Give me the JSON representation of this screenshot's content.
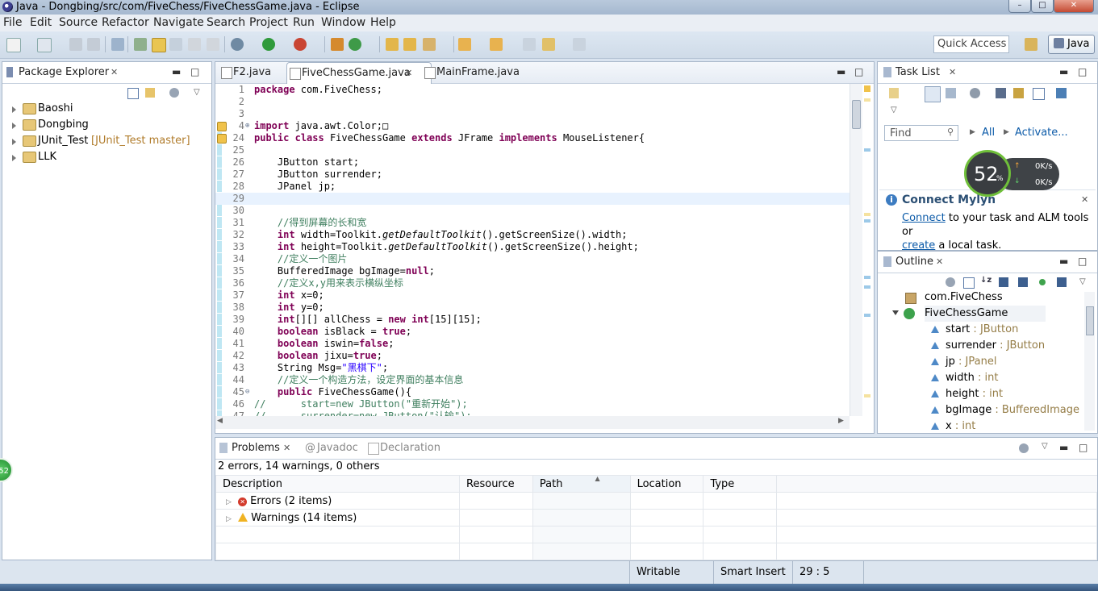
{
  "window": {
    "title": "Java - Dongbing/src/com/FiveChess/FiveChessGame.java - Eclipse"
  },
  "menu": [
    "File",
    "Edit",
    "Source",
    "Refactor",
    "Navigate",
    "Search",
    "Project",
    "Run",
    "Window",
    "Help"
  ],
  "toolbar": {
    "quick_access_placeholder": "Quick Access",
    "perspective": "Java"
  },
  "package_explorer": {
    "title": "Package Explorer",
    "projects": [
      {
        "name": "Baoshi",
        "decoration": ""
      },
      {
        "name": "Dongbing",
        "decoration": ""
      },
      {
        "name": "JUnit_Test",
        "decoration": "[JUnit_Test master]"
      },
      {
        "name": "LLK",
        "decoration": ""
      }
    ]
  },
  "editor": {
    "tabs": [
      "F2.java",
      "FiveChessGame.java",
      "MainFrame.java"
    ],
    "active_tab": "FiveChessGame.java",
    "cursor_line": 29,
    "lines": [
      {
        "n": "1",
        "t": "package com.FiveChess;"
      },
      {
        "n": "2",
        "t": ""
      },
      {
        "n": "3",
        "t": ""
      },
      {
        "n": "4",
        "t": "import java.awt.Color;□"
      },
      {
        "n": "24",
        "t": "public class FiveChessGame extends JFrame implements MouseListener{"
      },
      {
        "n": "25",
        "t": ""
      },
      {
        "n": "26",
        "t": "    JButton start;"
      },
      {
        "n": "27",
        "t": "    JButton surrender;"
      },
      {
        "n": "28",
        "t": "    JPanel jp;"
      },
      {
        "n": "29",
        "t": ""
      },
      {
        "n": "30",
        "t": ""
      },
      {
        "n": "31",
        "t": "    //得到屏幕的长和宽"
      },
      {
        "n": "32",
        "t": "    int width=Toolkit.getDefaultToolkit().getScreenSize().width;"
      },
      {
        "n": "33",
        "t": "    int height=Toolkit.getDefaultToolkit().getScreenSize().height;"
      },
      {
        "n": "34",
        "t": "    //定义一个图片"
      },
      {
        "n": "35",
        "t": "    BufferedImage bgImage=null;"
      },
      {
        "n": "36",
        "t": "    //定义x,y用来表示横纵坐标"
      },
      {
        "n": "37",
        "t": "    int x=0;"
      },
      {
        "n": "38",
        "t": "    int y=0;"
      },
      {
        "n": "39",
        "t": "    int[][] allChess = new int[15][15];"
      },
      {
        "n": "40",
        "t": "    boolean isBlack = true;"
      },
      {
        "n": "41",
        "t": "    boolean iswin=false;"
      },
      {
        "n": "42",
        "t": "    boolean jixu=true;"
      },
      {
        "n": "43",
        "t": "    String Msg=\"黑棋下\";"
      },
      {
        "n": "44",
        "t": "    //定义一个构造方法，设定界面的基本信息"
      },
      {
        "n": "45",
        "t": "    public FiveChessGame(){"
      },
      {
        "n": "46",
        "t": "//      start=new JButton(\"重新开始\");"
      },
      {
        "n": "47",
        "t": "//      surrender=new JButton(\"认输\");"
      }
    ]
  },
  "task_list": {
    "title": "Task List",
    "find_placeholder": "Find",
    "all_label": "All",
    "activate_label": "Activate...",
    "net_percent": "52",
    "net_up": "0K/s",
    "net_down": "0K/s",
    "mylyn_title": "Connect Mylyn",
    "mylyn_connect_link": "Connect",
    "mylyn_text1": " to your task and ALM tools or",
    "mylyn_create_link": "create",
    "mylyn_text2": " a local task."
  },
  "outline": {
    "title": "Outline",
    "package": "com.FiveChess",
    "class": "FiveChessGame",
    "fields": [
      {
        "name": "start",
        "type": "JButton"
      },
      {
        "name": "surrender",
        "type": "JButton"
      },
      {
        "name": "jp",
        "type": "JPanel"
      },
      {
        "name": "width",
        "type": "int"
      },
      {
        "name": "height",
        "type": "int"
      },
      {
        "name": "bgImage",
        "type": "BufferedImage"
      },
      {
        "name": "x",
        "type": "int"
      }
    ]
  },
  "problems": {
    "tabs": [
      "Problems",
      "Javadoc",
      "Declaration"
    ],
    "summary": "2 errors, 14 warnings, 0 others",
    "columns": [
      "Description",
      "Resource",
      "Path",
      "Location",
      "Type"
    ],
    "rows": [
      {
        "label": "Errors (2 items)",
        "kind": "error"
      },
      {
        "label": "Warnings (14 items)",
        "kind": "warning"
      }
    ]
  },
  "status": {
    "writable": "Writable",
    "insert_mode": "Smart Insert",
    "position": "29 : 5"
  },
  "side_badge": "52",
  "colors": {
    "keyword": "#7f0055",
    "comment": "#3f7f5f",
    "string": "#2a00ff",
    "field": "#0000c0",
    "link": "#0b5aa8"
  }
}
